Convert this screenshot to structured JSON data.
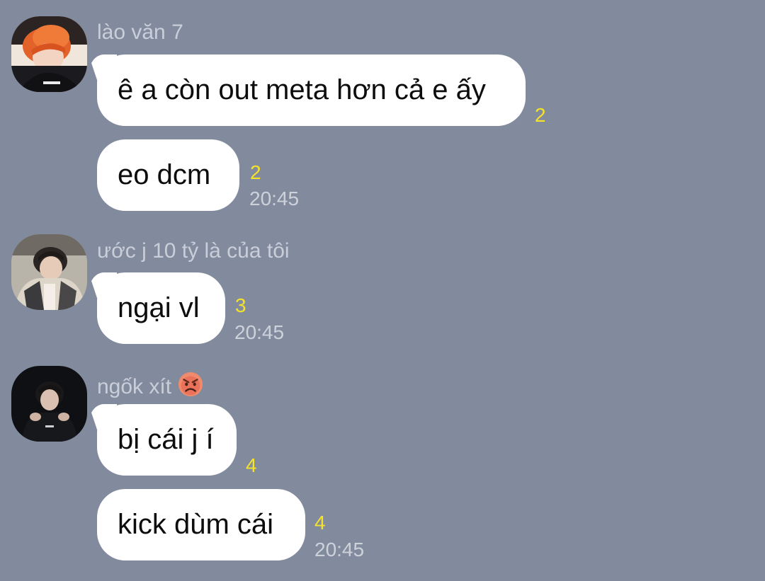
{
  "colors": {
    "background": "#828b9d",
    "bubble": "#ffffff",
    "read_count": "#f5e22a",
    "sender_name": "#c9ced9",
    "timestamp": "#cdd1da"
  },
  "groups": [
    {
      "sender": "lào văn 7",
      "avatar_icon": "user-avatar-orange-hair",
      "messages": [
        {
          "text": "ê a còn out meta hơn cả e ấy",
          "read_count": "2"
        },
        {
          "text": "eo dcm",
          "read_count": "2",
          "time": "20:45"
        }
      ]
    },
    {
      "sender": "ước j 10 tỷ là của tôi",
      "avatar_icon": "user-avatar-jacket",
      "messages": [
        {
          "text": "ngại vl",
          "read_count": "3",
          "time": "20:45"
        }
      ]
    },
    {
      "sender": "ngốk xít",
      "sender_emoji": "angry-face-emoji",
      "avatar_icon": "user-avatar-dark",
      "messages": [
        {
          "text": "bị cái j í",
          "read_count": "4"
        },
        {
          "text": "kick dùm cái",
          "read_count": "4",
          "time": "20:45"
        }
      ]
    }
  ]
}
